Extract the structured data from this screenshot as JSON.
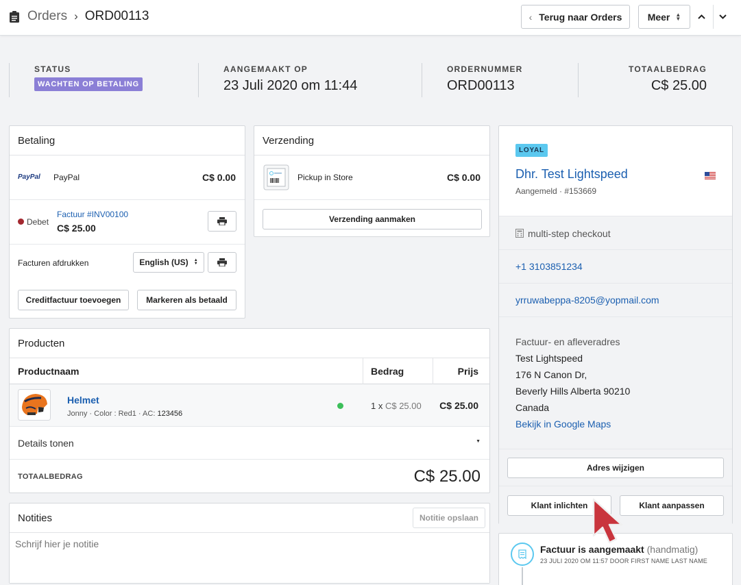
{
  "breadcrumb": {
    "parent": "Orders",
    "current": "ORD00113"
  },
  "header_buttons": {
    "back": "Terug naar Orders",
    "more": "Meer"
  },
  "stats": {
    "status_label": "STATUS",
    "status_value": "WACHTEN OP BETALING",
    "created_label": "AANGEMAAKT OP",
    "created_value": "23 Juli 2020 om 11:44",
    "order_label": "ORDERNUMMER",
    "order_value": "ORD00113",
    "total_label": "TOTAALBEDRAG",
    "total_value": "C$ 25.00"
  },
  "payment": {
    "title": "Betaling",
    "paypal_logo": "PayPal",
    "paypal_name": "PayPal",
    "paypal_amount": "C$ 0.00",
    "debet_label": "Debet",
    "invoice_link": "Factuur #INV00100",
    "invoice_amount": "C$ 25.00",
    "print_invoices_label": "Facturen afdrukken",
    "language": "English (US)",
    "credit_button": "Creditfactuur toevoegen",
    "mark_paid_button": "Markeren als betaald"
  },
  "shipping": {
    "title": "Verzending",
    "method": "Pickup in Store",
    "amount": "C$ 0.00",
    "create_button": "Verzending aanmaken"
  },
  "products": {
    "title": "Producten",
    "col_name": "Productnaam",
    "col_amount": "Bedrag",
    "col_price": "Prijs",
    "items": [
      {
        "name": "Helmet",
        "meta": "Jonny · Color : Red1 · AC:",
        "sku": "123456",
        "qty": "1 x",
        "unit_price": "C$ 25.00",
        "price": "C$ 25.00"
      }
    ],
    "details_toggle": "Details tonen",
    "total_label": "TOTAALBEDRAG",
    "total_value": "C$ 25.00"
  },
  "notes": {
    "title": "Notities",
    "save_button": "Notitie opslaan",
    "placeholder": "Schrijf hier je notitie"
  },
  "customer": {
    "tag": "LOYAL",
    "name": "Dhr. Test Lightspeed",
    "subtitle": "Aangemeld · #153669",
    "checkout": "multi-step checkout",
    "phone": "+1 3103851234",
    "email": "yrruwabeppa-8205@yopmail.com",
    "address_label": "Factuur- en afleveradres",
    "address_lines": [
      "Test Lightspeed",
      "176 N Canon Dr,",
      "Beverly Hills Alberta 90210",
      "Canada"
    ],
    "maps_link": "Bekijk in Google Maps",
    "change_address_button": "Adres wijzigen",
    "notify_button": "Klant inlichten",
    "edit_button": "Klant aanpassen"
  },
  "timeline": {
    "title": "Factuur is aangemaakt",
    "title_suffix": "(handmatig)",
    "meta": "23 JULI 2020 OM 11:57 DOOR FIRST NAME LAST NAME"
  },
  "colors": {
    "accent_link": "#1b5fb0",
    "status_badge": "#8b7fd6",
    "loyal_badge": "#5bc8ef",
    "in_stock": "#3cbf5a",
    "cursor": "#c9353d"
  }
}
